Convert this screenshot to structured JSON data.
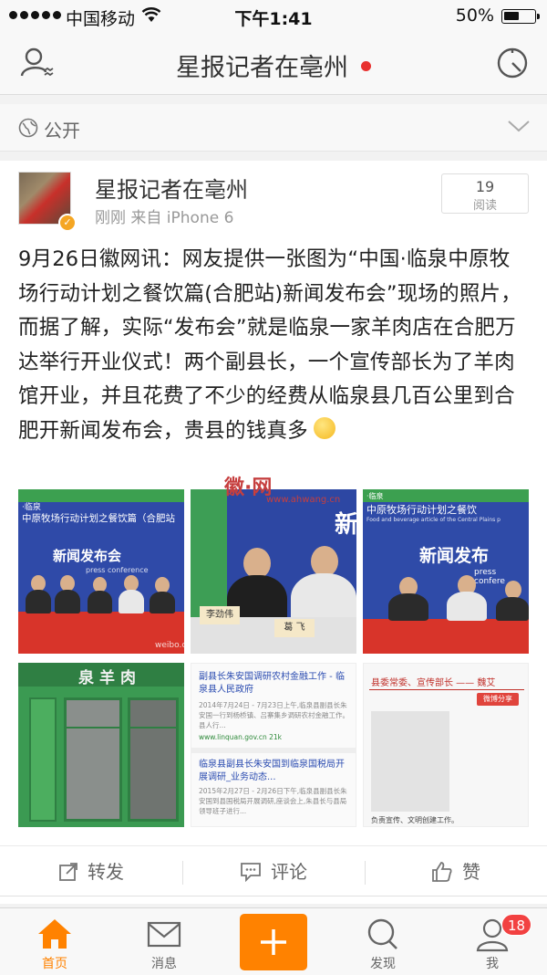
{
  "status_bar": {
    "carrier": "中国移动",
    "time": "下午1:41",
    "battery": "50%"
  },
  "nav": {
    "title": "星报记者在亳州"
  },
  "visibility": {
    "label": "公开"
  },
  "post": {
    "author": "星报记者在亳州",
    "meta": "刚刚  来自 iPhone 6",
    "read_count": "19",
    "read_label": "阅读",
    "text": "9月26日徽网讯：网友提供一张图为“中国·临泉中原牧场行动计划之餐饮篇(合肥站)新闻发布会”现场的照片，而据了解，实际“发布会”就是临泉一家羊肉店在合肥万达举行开业仪式！两个副县长，一个宣传部长为了羊肉馆开业，并且花费了不少的经费从临泉县几百公里到合肥开新闻发布会，贵县的钱真多"
  },
  "images": {
    "p1": {
      "banner_title": "中原牧场行动计划之餐饮篇（合肥站",
      "banner_prefix": "·临泉",
      "board_text": "新闻发布会",
      "subtitle": "press conference",
      "watermark": "weibo.co"
    },
    "p2": {
      "side_text": "新",
      "name_card_1": "李劲伟",
      "name_card_2": "葛 飞"
    },
    "p3": {
      "banner_prefix": "·临泉",
      "banner_title": "中原牧场行动计划之餐饮",
      "banner_en": "Food and beverage article of the Central Plains p",
      "board_text": "新闻发布",
      "subtitle": "press confere"
    },
    "p4": {
      "sign_text": "泉羊肉"
    },
    "p5": {
      "r1_title": "副县长朱安国调研农村金融工作 - 临泉县人民政府",
      "r1_snippet": "2014年7月24日 - 7月23日上午,临泉县副县长朱安国一行到杨桥镇、吕寨集乡调研农村金融工作。县人行...",
      "r1_url": "www.linquan.gov.cn  21k",
      "r2_title": "临泉县副县长朱安国到临泉国税局开展调研_业务动态...",
      "r2_snippet": "2015年2月27日 - 2月26日下午,临泉县副县长朱安国到县国税局开展调研,座谈会上,朱县长与县局领导班子进行..."
    },
    "p6": {
      "title": "县委常委、宣传部长 ——  魏艾",
      "button": "微博分享",
      "caption": "负责宣传、文明创建工作。"
    },
    "watermark_logo": "徽·网",
    "watermark_url": "www.ahwang.cn"
  },
  "actions": {
    "repost": "转发",
    "comment": "评论",
    "like": "赞"
  },
  "tabs": {
    "home": "首页",
    "messages": "消息",
    "discover": "发现",
    "me": "我",
    "badge": "18"
  },
  "colors": {
    "accent": "#ff8200",
    "badge": "#f24141",
    "live_dot": "#e8312f"
  }
}
